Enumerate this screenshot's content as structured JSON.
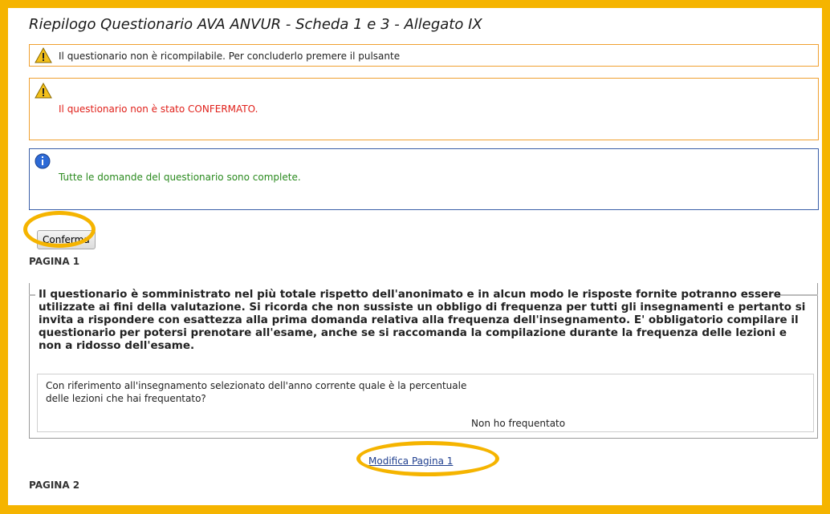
{
  "title": "Riepilogo Questionario AVA ANVUR - Scheda 1 e 3 - Allegato IX",
  "messages": {
    "warning1": "Il questionario non è ricompilabile. Per concluderlo premere il pulsante",
    "warning2_prefix": "Il questionario non è stato ",
    "warning2_emph": "CONFERMATO.",
    "info": "Tutte le domande del questionario sono complete."
  },
  "buttons": {
    "confirm": "Conferma"
  },
  "page1": {
    "label": "PAGINA 1",
    "intro": "Il questionario è somministrato nel più totale rispetto dell'anonimato e in alcun modo le risposte fornite potranno essere utilizzate ai fini della valutazione. Si ricorda che non sussiste un obbligo di frequenza per tutti gli insegnamenti e pertanto si invita a rispondere con esattezza alla prima domanda relativa alla frequenza dell'insegnamento. E' obbligatorio compilare il questionario per potersi prenotare all'esame, anche se si raccomanda la compilazione durante la frequenza delle lezioni e non a ridosso dell'esame.",
    "question": "Con riferimento all'insegnamento selezionato dell'anno corrente quale è la percentuale delle lezioni che hai frequentato?",
    "answer": "Non ho frequentato",
    "edit_link": "Modifica Pagina 1"
  },
  "page2": {
    "label": "PAGINA 2"
  },
  "colors": {
    "highlight": "#f5b400",
    "warn_border": "#f0a030",
    "info_border": "#3a5fa8",
    "error_text": "#e0201a",
    "success_text": "#2a8a1e"
  }
}
